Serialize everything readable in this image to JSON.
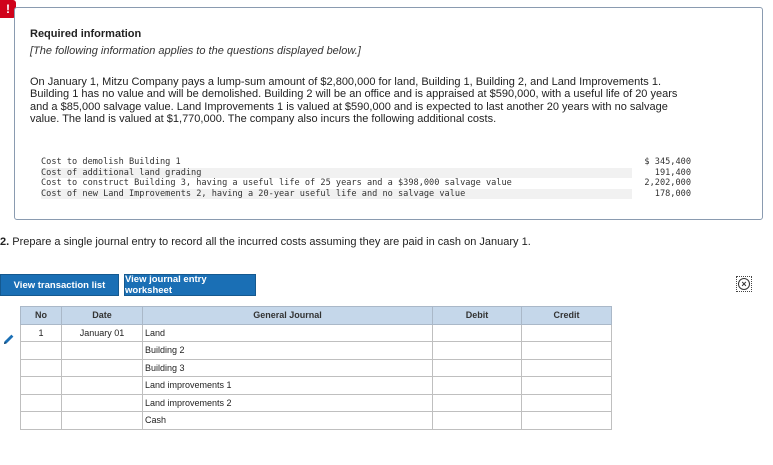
{
  "alert": {
    "glyph": "!"
  },
  "info": {
    "title": "Required information",
    "subtitle": "[The following information applies to the questions displayed below.]",
    "paragraph": "On January 1, Mitzu Company pays a lump-sum amount of $2,800,000 for land, Building 1, Building 2, and Land Improvements 1. Building 1 has no value and will be demolished. Building 2 will be an office and is appraised at $590,000, with a useful life of 20 years and a $85,000 salvage value. Land Improvements 1 is valued at $590,000 and is expected to last another 20 years with no salvage value. The land is valued at $1,770,000. The company also incurs the following additional costs.",
    "costs": [
      {
        "desc": "Cost to demolish Building 1",
        "amount": "$ 345,400"
      },
      {
        "desc": "Cost of additional land grading",
        "amount": "191,400"
      },
      {
        "desc": "Cost to construct Building 3, having a useful life of 25 years and a $398,000 salvage value",
        "amount": "2,202,000"
      },
      {
        "desc": "Cost of new Land Improvements 2, having a 20-year useful life and no salvage value",
        "amount": "178,000"
      }
    ]
  },
  "question": {
    "number": "2.",
    "text": " Prepare a single journal entry to record all the incurred costs assuming they are paid in cash on January 1."
  },
  "buttons": {
    "transaction_list": "View transaction list",
    "journal_worksheet": "View journal entry worksheet"
  },
  "journal": {
    "headers": {
      "no": "No",
      "date": "Date",
      "general_journal": "General Journal",
      "debit": "Debit",
      "credit": "Credit"
    },
    "entry_no": "1",
    "entry_date": "January 01",
    "accounts": [
      "Land",
      "Building 2",
      "Building 3",
      "Land improvements 1",
      "Land improvements 2",
      "Cash"
    ]
  },
  "icons": {
    "edit": "pencil-icon",
    "close": "close-circle-icon"
  },
  "colors": {
    "accent": "#1a6fb5",
    "alert": "#d0021b",
    "table_header": "#c5d7ea"
  }
}
